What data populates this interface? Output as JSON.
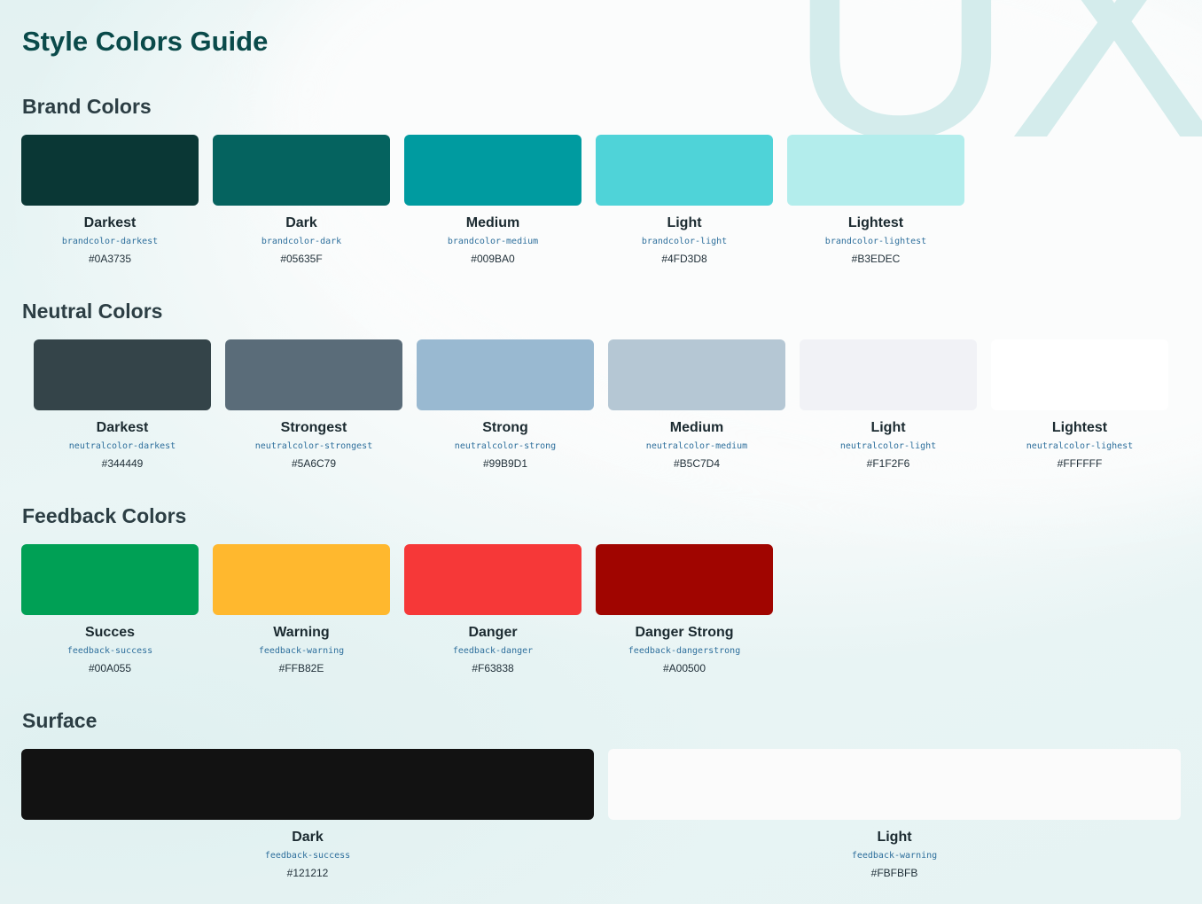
{
  "page": {
    "title": "Style Colors Guide",
    "watermark": "UX"
  },
  "sections": {
    "brand": {
      "title": "Brand Colors",
      "swatches": [
        {
          "name": "Darkest",
          "token": "brandcolor-darkest",
          "hex": "#0A3735",
          "color": "#0A3735"
        },
        {
          "name": "Dark",
          "token": "brandcolor-dark",
          "hex": "#05635F",
          "color": "#05635F"
        },
        {
          "name": "Medium",
          "token": "brandcolor-medium",
          "hex": "#009BA0",
          "color": "#009BA0"
        },
        {
          "name": "Light",
          "token": "brandcolor-light",
          "hex": "#4FD3D8",
          "color": "#4FD3D8"
        },
        {
          "name": "Lightest",
          "token": "brandcolor-lightest",
          "hex": "#B3EDEC",
          "color": "#B3EDEC"
        }
      ]
    },
    "neutral": {
      "title": "Neutral Colors",
      "swatches": [
        {
          "name": "Darkest",
          "token": "neutralcolor-darkest",
          "hex": "#344449",
          "color": "#344449"
        },
        {
          "name": "Strongest",
          "token": "neutralcolor-strongest",
          "hex": "#5A6C79",
          "color": "#5A6C79"
        },
        {
          "name": "Strong",
          "token": "neutralcolor-strong",
          "hex": "#99B9D1",
          "color": "#99B9D1"
        },
        {
          "name": "Medium",
          "token": "neutralcolor-medium",
          "hex": "#B5C7D4",
          "color": "#B5C7D4"
        },
        {
          "name": "Light",
          "token": "neutralcolor-light",
          "hex": "#F1F2F6",
          "color": "#F1F2F6"
        },
        {
          "name": "Lightest",
          "token": "neutralcolor-lighest",
          "hex": "#FFFFFF",
          "color": "#FFFFFF"
        }
      ]
    },
    "feedback": {
      "title": "Feedback Colors",
      "swatches": [
        {
          "name": "Succes",
          "token": "feedback-success",
          "hex": "#00A055",
          "color": "#00A055"
        },
        {
          "name": "Warning",
          "token": "feedback-warning",
          "hex": "#FFB82E",
          "color": "#FFB82E"
        },
        {
          "name": "Danger",
          "token": "feedback-danger",
          "hex": "#F63838",
          "color": "#F63838"
        },
        {
          "name": "Danger Strong",
          "token": "feedback-dangerstrong",
          "hex": "#A00500",
          "color": "#A00500"
        }
      ]
    },
    "surface": {
      "title": "Surface",
      "swatches": [
        {
          "name": "Dark",
          "token": "feedback-success",
          "hex": "#121212",
          "color": "#121212"
        },
        {
          "name": "Light",
          "token": "feedback-warning",
          "hex": "#FBFBFB",
          "color": "#FBFBFB"
        }
      ]
    }
  }
}
